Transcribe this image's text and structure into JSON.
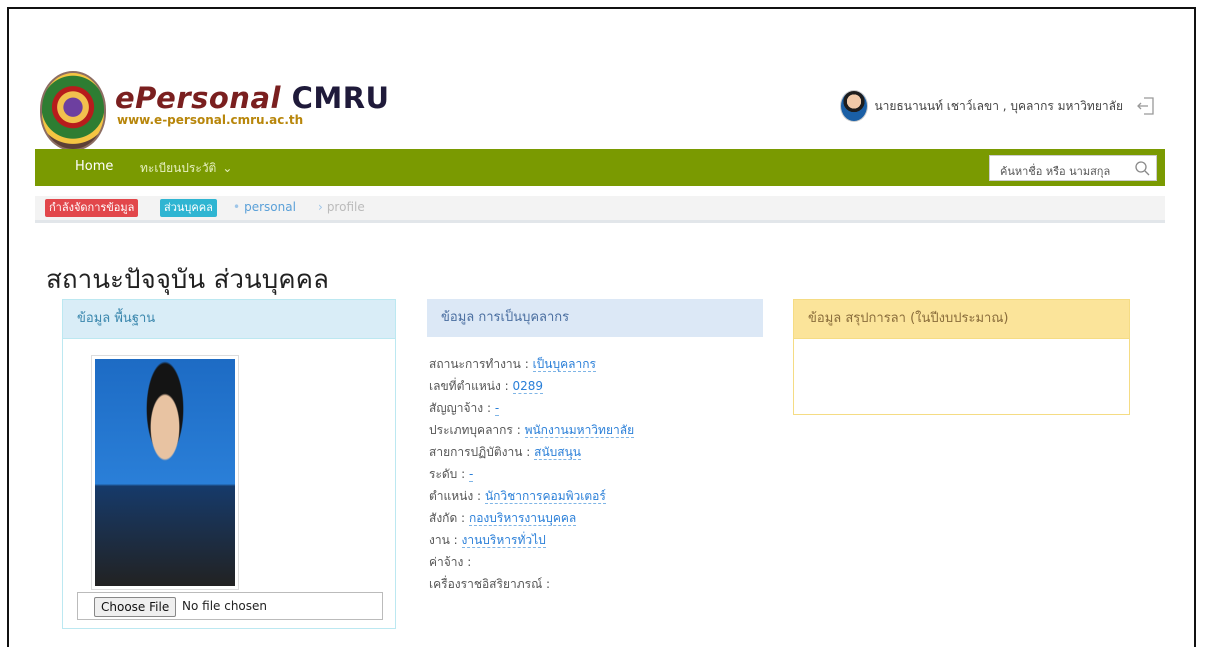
{
  "header": {
    "brand_title_a": "ePersonal",
    "brand_title_b": "CMRU",
    "brand_url": "www.e-personal.cmru.ac.th",
    "user_name": "นายธนานนท์ เชาว์เลขา , บุคลากร มหาวิทยาลัย"
  },
  "navbar": {
    "home_label": "Home",
    "registry_label": "ทะเบียนประวัติ",
    "search_placeholder": "ค้นหาชื่อ หรือ นามสกุล"
  },
  "breadcrumb": {
    "badge_manage": "กำลังจัดการข้อมูล",
    "badge_personal": "ส่วนบุคคล",
    "link": "personal",
    "current": "profile"
  },
  "page_title": "สถานะปัจจุบัน ส่วนบุคคล",
  "panels": {
    "basic": {
      "title": "ข้อมูล พื้นฐาน"
    },
    "employment": {
      "title": "ข้อมูล การเป็นบุคลากร"
    },
    "leave": {
      "title": "ข้อมูล สรุปการลา (ในปีงบประมาณ)"
    }
  },
  "file_input": {
    "button_label": "Choose File",
    "status": "No file chosen"
  },
  "employment_rows": [
    {
      "label": "สถานะการทำงาน :",
      "value": "เป็นบุคลากร"
    },
    {
      "label": "เลขที่ตำแหน่ง :",
      "value": "0289"
    },
    {
      "label": "สัญญาจ้าง :",
      "value": "-"
    },
    {
      "label": "ประเภทบุคลากร :",
      "value": "พนักงานมหาวิทยาลัย"
    },
    {
      "label": "สายการปฏิบัติงาน :",
      "value": "สนับสนุน"
    },
    {
      "label": "ระดับ :",
      "value": "-"
    },
    {
      "label": "ตำแหน่ง :",
      "value": "นักวิชาการคอมพิวเตอร์"
    },
    {
      "label": "สังกัด :",
      "value": "กองบริหารงานบุคคล"
    },
    {
      "label": "งาน :",
      "value": "งานบริหารทั่วไป"
    },
    {
      "label": "ค่าจ้าง :",
      "value": ""
    },
    {
      "label": "เครื่องราชอิสริยาภรณ์ :",
      "value": ""
    }
  ],
  "colors": {
    "navbar": "#7a9a01",
    "badge_red": "#e2474b",
    "badge_cyan": "#2fb5d2",
    "link_blue": "#2a7fd8"
  },
  "icons": {
    "logout": "logout-icon",
    "search": "search-icon",
    "chevron": "chevron-down-icon"
  }
}
